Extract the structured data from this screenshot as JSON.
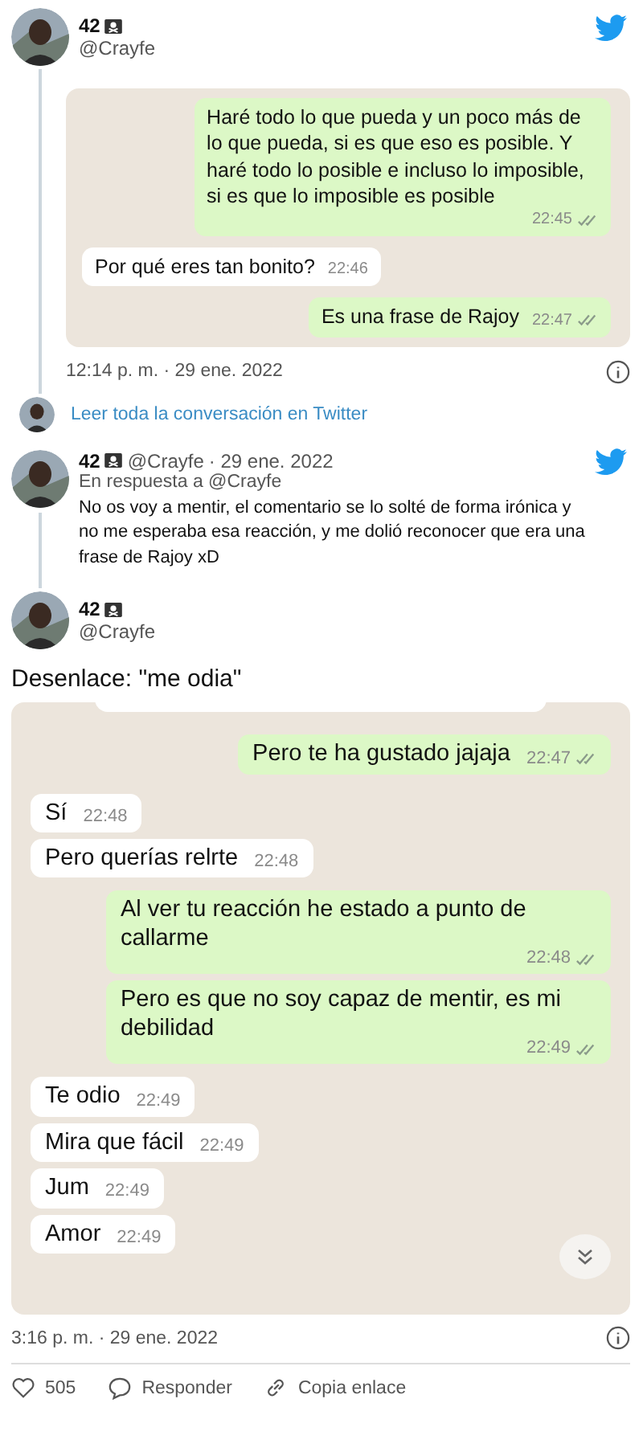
{
  "tweets": [
    {
      "kind": "quoted",
      "name": "42",
      "handle": "@Crayfe",
      "chat": [
        {
          "kind": "sent",
          "text": "Haré todo lo que pueda y un poco más de lo que pueda, si es que eso es posible. Y haré todo lo posible e incluso lo imposible, si es que lo imposible es posible",
          "time": "22:45"
        },
        {
          "kind": "received",
          "text": "Por qué eres tan bonito?",
          "time": "22:46"
        },
        {
          "kind": "sent",
          "text": "Es una frase de Rajoy",
          "time": "22:47"
        }
      ],
      "timestamp": "12:14 p. m. · 29 ene. 2022",
      "read_more": "Leer toda la conversación en Twitter"
    },
    {
      "kind": "reply",
      "name": "42",
      "handle": "@Crayfe",
      "date": "· 29 ene. 2022",
      "reply_to": "En respuesta a @Crayfe",
      "body": "No os voy a mentir, el comentario se lo solté de forma irónica y no me esperaba esa reacción, y me dolió reconocer que era una frase de Rajoy xD"
    },
    {
      "kind": "main",
      "name": "42",
      "handle": "@Crayfe",
      "body": "Desenlace: \"me odia\"",
      "chat": [
        {
          "kind": "sent",
          "text": "Pero te ha gustado jajaja",
          "time": "22:47"
        },
        {
          "kind": "received",
          "text": "Sí",
          "time": "22:48"
        },
        {
          "kind": "received",
          "text": "Pero querías relrte",
          "time": "22:48"
        },
        {
          "kind": "sent",
          "text": "Al ver tu reacción he estado a punto de callarme",
          "time": "22:48"
        },
        {
          "kind": "sent",
          "text": "Pero es que no soy capaz de mentir, es mi debilidad",
          "time": "22:49"
        },
        {
          "kind": "received",
          "text": "Te odio",
          "time": "22:49"
        },
        {
          "kind": "received",
          "text": "Mira que fácil",
          "time": "22:49"
        },
        {
          "kind": "received",
          "text": "Jum",
          "time": "22:49"
        },
        {
          "kind": "received",
          "text": "Amor",
          "time": "22:49"
        }
      ],
      "timestamp": "3:16 p. m. · 29 ene. 2022",
      "likes": "505",
      "reply_label": "Responder",
      "copy_label": "Copia enlace"
    }
  ]
}
